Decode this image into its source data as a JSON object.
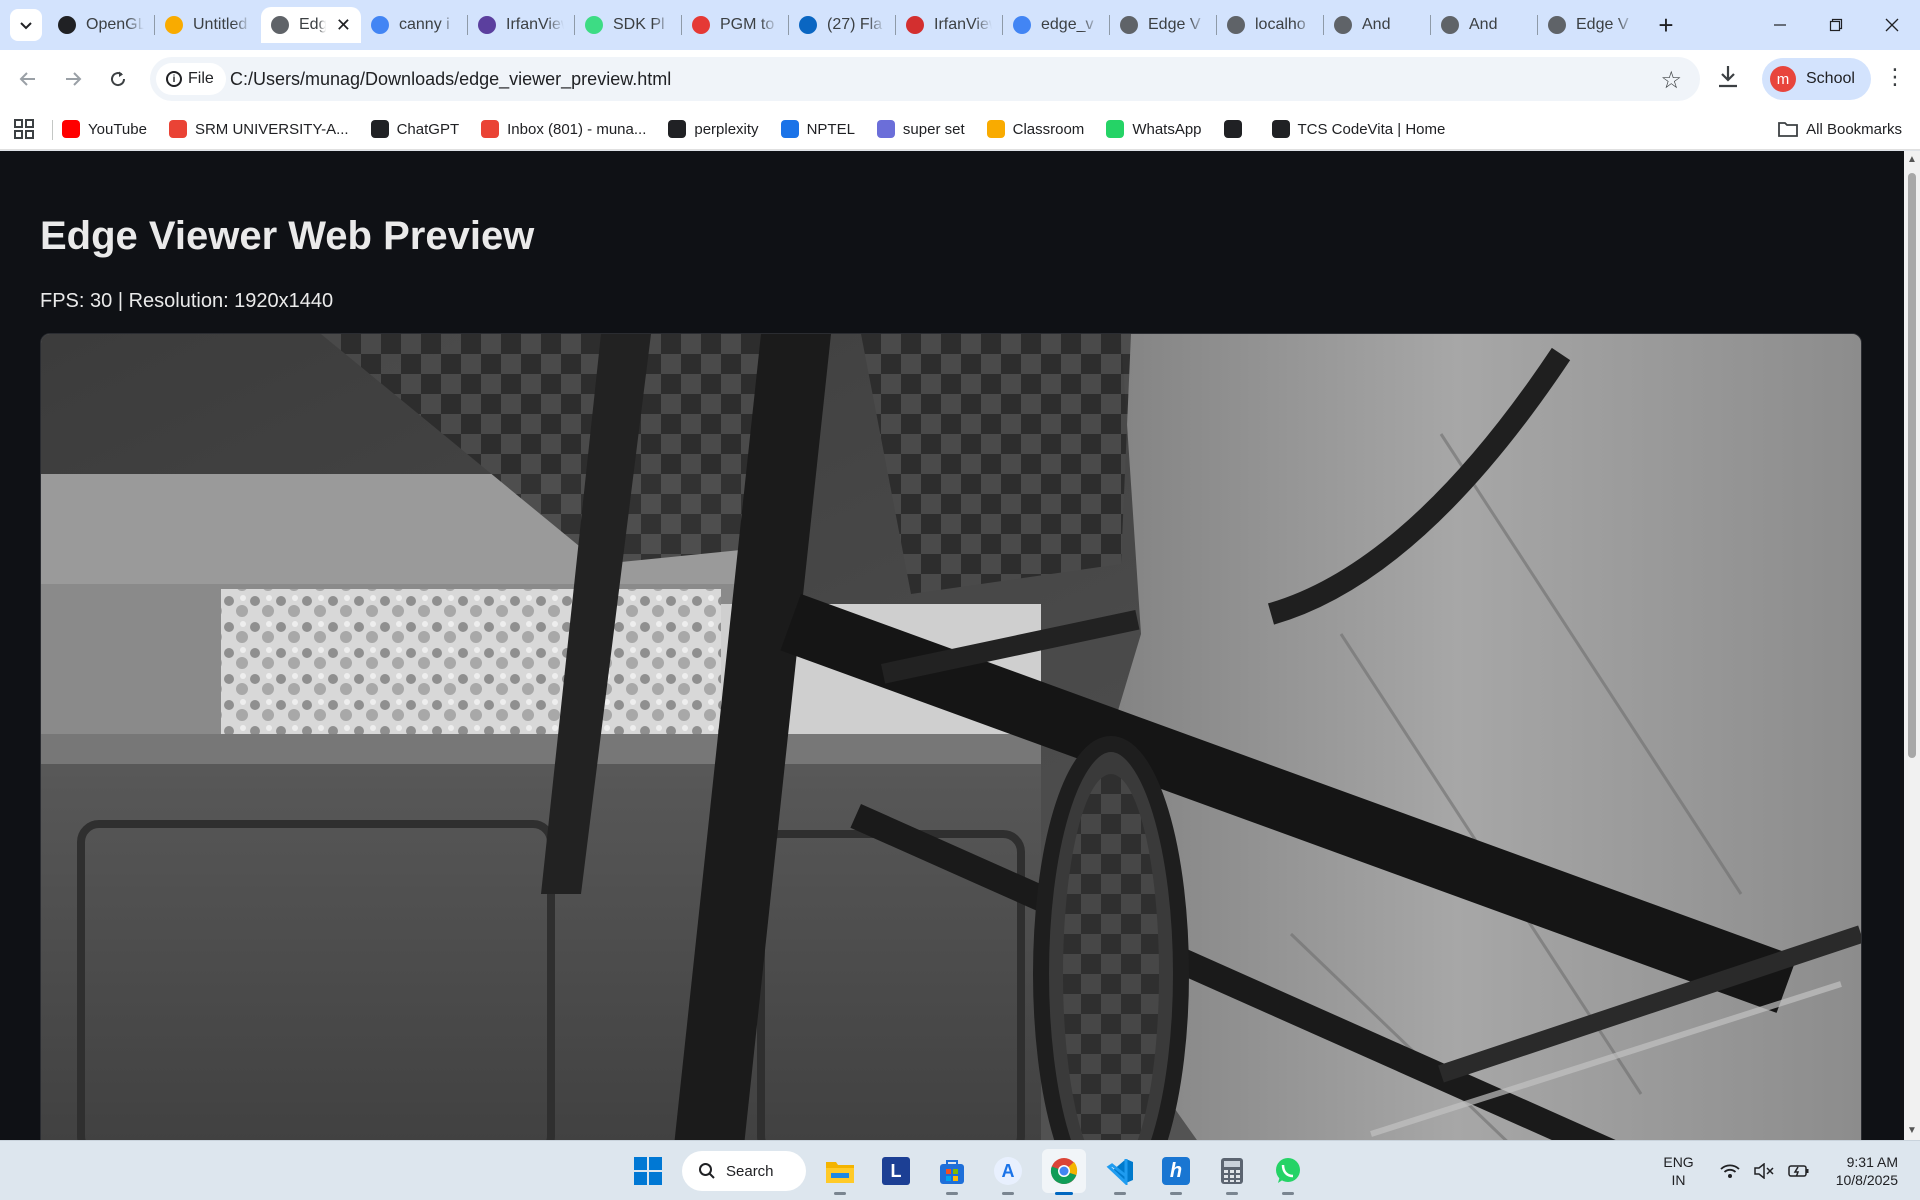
{
  "browser": {
    "tabs": [
      {
        "title": "OpenGL",
        "icon": "openai-icon",
        "color": "#202124"
      },
      {
        "title": "Untitled",
        "icon": "colab-icon",
        "color": "#f9ab00"
      },
      {
        "title": "Edge",
        "icon": "globe-icon",
        "color": "#5f6368",
        "active": true
      },
      {
        "title": "canny i",
        "icon": "google-icon",
        "color": "#4285f4"
      },
      {
        "title": "IrfanView",
        "icon": "irfanview-icon",
        "color": "#5b3f9e"
      },
      {
        "title": "SDK Pl",
        "icon": "android-icon",
        "color": "#3ddc84"
      },
      {
        "title": "PGM to",
        "icon": "pgm-icon",
        "color": "#e53935"
      },
      {
        "title": "(27) Fla",
        "icon": "linkedin-icon",
        "color": "#0a66c2"
      },
      {
        "title": "IrfanView",
        "icon": "irfanview-red-icon",
        "color": "#d32f2f"
      },
      {
        "title": "edge_v",
        "icon": "google-icon",
        "color": "#4285f4"
      },
      {
        "title": "Edge V",
        "icon": "globe-icon",
        "color": "#5f6368"
      },
      {
        "title": "localho",
        "icon": "globe-icon",
        "color": "#5f6368"
      },
      {
        "title": "And",
        "icon": "globe-icon",
        "color": "#5f6368"
      },
      {
        "title": "And",
        "icon": "globe-icon",
        "color": "#5f6368"
      },
      {
        "title": "Edge V",
        "icon": "globe-icon",
        "color": "#5f6368"
      }
    ],
    "site_chip": "File",
    "url": "C:/Users/munag/Downloads/edge_viewer_preview.html",
    "profile": {
      "initial": "m",
      "label": "School"
    },
    "bookmarks": [
      {
        "label": "YouTube",
        "icon": "youtube-icon",
        "color": "#ff0000"
      },
      {
        "label": "SRM UNIVERSITY-A...",
        "icon": "gmail-icon",
        "color": "#ea4335"
      },
      {
        "label": "ChatGPT",
        "icon": "openai-icon",
        "color": "#202124"
      },
      {
        "label": "Inbox (801) - muna...",
        "icon": "gmail-icon",
        "color": "#ea4335"
      },
      {
        "label": "perplexity",
        "icon": "perplexity-icon",
        "color": "#202124"
      },
      {
        "label": "NPTEL",
        "icon": "nptel-icon",
        "color": "#1a73e8"
      },
      {
        "label": "super set",
        "icon": "superset-icon",
        "color": "#6b6ed9"
      },
      {
        "label": "Classroom",
        "icon": "classroom-icon",
        "color": "#f9ab00"
      },
      {
        "label": "WhatsApp",
        "icon": "whatsapp-icon",
        "color": "#25d366"
      },
      {
        "label": "",
        "icon": "globe-icon",
        "color": "#202124"
      },
      {
        "label": "TCS CodeVita | Home",
        "icon": "tcs-icon",
        "color": "#202124"
      }
    ],
    "all_bookmarks": "All Bookmarks"
  },
  "page": {
    "title": "Edge Viewer Web Preview",
    "status": "FPS: 30 | Resolution: 1920x1440",
    "background": "#0f1115",
    "text_color": "#eaeaea"
  },
  "taskbar": {
    "search_label": "Search",
    "apps": [
      "start-icon",
      "search",
      "file-explorer-icon",
      "l-app-icon",
      "store-icon",
      "app-a-icon",
      "chrome-icon",
      "vscode-icon",
      "h-app-icon",
      "calculator-icon",
      "whatsapp-icon"
    ],
    "language": [
      "ENG",
      "IN"
    ],
    "time": "9:31 AM",
    "date": "10/8/2025"
  }
}
